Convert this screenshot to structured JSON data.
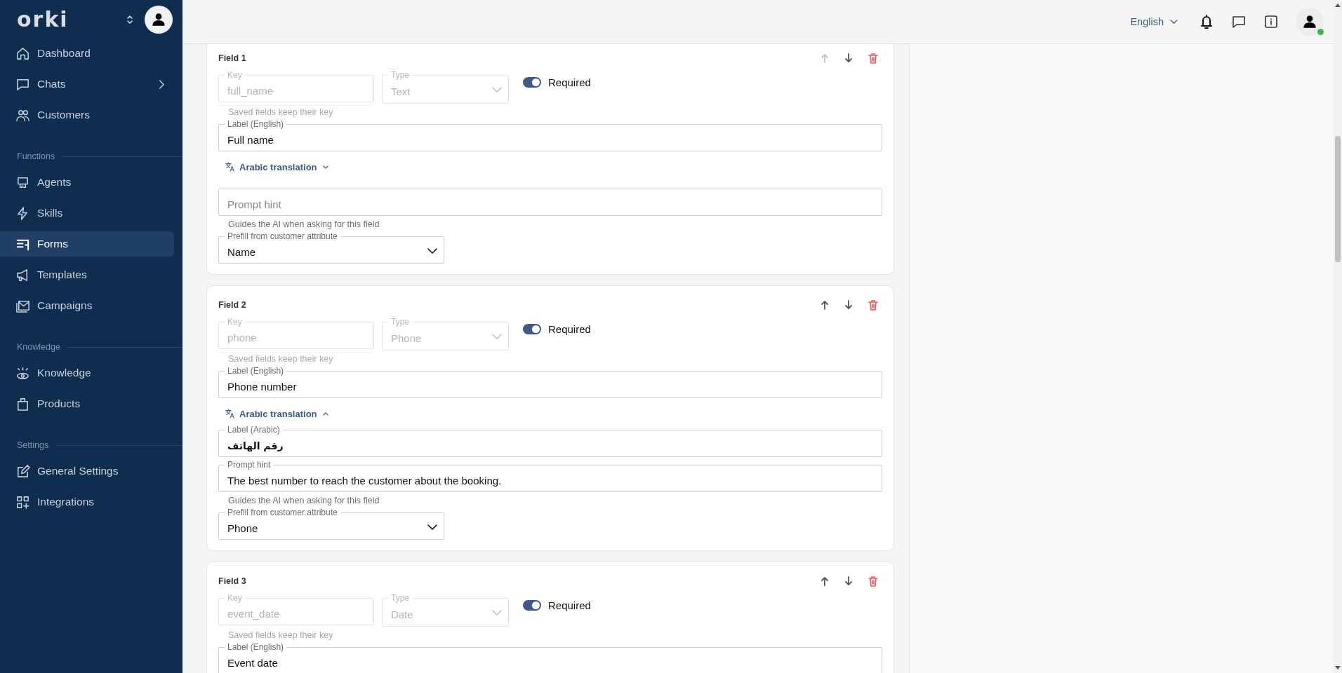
{
  "sidebar": {
    "logo": "orki",
    "groups": [
      {
        "items": [
          {
            "label": "Dashboard",
            "selected": false,
            "expandable": false
          },
          {
            "label": "Chats",
            "selected": false,
            "expandable": true
          },
          {
            "label": "Customers",
            "selected": false,
            "expandable": false
          }
        ]
      },
      {
        "title": "Functions",
        "items": [
          {
            "label": "Agents",
            "selected": false,
            "expandable": false
          },
          {
            "label": "Skills",
            "selected": false,
            "expandable": false
          },
          {
            "label": "Forms",
            "selected": true,
            "expandable": false
          },
          {
            "label": "Templates",
            "selected": false,
            "expandable": false
          },
          {
            "label": "Campaigns",
            "selected": false,
            "expandable": false
          }
        ]
      },
      {
        "title": "Knowledge",
        "items": [
          {
            "label": "Knowledge",
            "selected": false,
            "expandable": false
          },
          {
            "label": "Products",
            "selected": false,
            "expandable": false
          }
        ]
      },
      {
        "title": "Settings",
        "items": [
          {
            "label": "General Settings",
            "selected": false,
            "expandable": false
          },
          {
            "label": "Integrations",
            "selected": false,
            "expandable": false
          }
        ]
      }
    ]
  },
  "topbar": {
    "language": "English",
    "user_online": true
  },
  "fields": [
    {
      "title": "Field 1",
      "move_up_disabled": true,
      "key": {
        "label": "Key",
        "value": "full_name",
        "disabled": true
      },
      "type": {
        "label": "Type",
        "value": "Text",
        "disabled": true
      },
      "required": {
        "label": "Required",
        "on": true
      },
      "key_helper": "Saved fields keep their key",
      "label_en": {
        "label": "Label (English)",
        "value": "Full name"
      },
      "translation": {
        "label": "Arabic translation",
        "expanded": false
      },
      "prompt": {
        "placeholder": "Prompt hint"
      },
      "prompt_helper": "Guides the AI when asking for this field",
      "prefill": {
        "label": "Prefill from customer attribute",
        "value": "Name"
      }
    },
    {
      "title": "Field 2",
      "move_up_disabled": false,
      "key": {
        "label": "Key",
        "value": "phone",
        "disabled": true
      },
      "type": {
        "label": "Type",
        "value": "Phone",
        "disabled": true
      },
      "required": {
        "label": "Required",
        "on": true
      },
      "key_helper": "Saved fields keep their key",
      "label_en": {
        "label": "Label (English)",
        "value": "Phone number"
      },
      "translation": {
        "label": "Arabic translation",
        "expanded": true
      },
      "label_ar": {
        "label": "Label (Arabic)",
        "value": "رقم الهاتف"
      },
      "prompt": {
        "label": "Prompt hint",
        "value": "The best number to reach the customer about the booking."
      },
      "prompt_helper": "Guides the AI when asking for this field",
      "prefill": {
        "label": "Prefill from customer attribute",
        "value": "Phone"
      }
    },
    {
      "title": "Field 3",
      "move_up_disabled": false,
      "key": {
        "label": "Key",
        "value": "event_date",
        "disabled": true
      },
      "type": {
        "label": "Type",
        "value": "Date",
        "disabled": true
      },
      "required": {
        "label": "Required",
        "on": true
      },
      "key_helper": "Saved fields keep their key",
      "label_en": {
        "label": "Label (English)",
        "value": "Event date"
      }
    }
  ]
}
